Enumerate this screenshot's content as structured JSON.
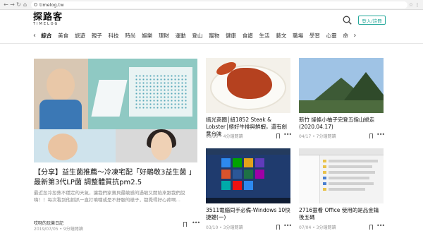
{
  "browser": {
    "url": "timelog.tw"
  },
  "header": {
    "logo_main": "探路客",
    "logo_sub": "TIMELOG",
    "login_label": "登入/註冊"
  },
  "categories": [
    "綜合",
    "美食",
    "旅遊",
    "親子",
    "科技",
    "時尚",
    "娛樂",
    "理財",
    "運動",
    "登山",
    "寵物",
    "健康",
    "食譜",
    "生活",
    "藝文",
    "職場",
    "學習",
    "心靈",
    "命"
  ],
  "featured": {
    "title": "【分享】益生菌推薦～冷凍宅配「好鵰敬3益生菌 」最新第3代LP菌 調整體質抗pm2.5",
    "excerpt": "最近忽冷忽熱不穩定的天氣，讓我們家寶貝最敏感的過敏又開始來跟我們說嗨！！每次看到他抓抓一直打噴嚏或是不舒服的樣子，都覺得好心疼啊…",
    "author": "哎呀的玩樂日記",
    "meta": "2019/07/05 • 9分鐘閱讀"
  },
  "cards": [
    {
      "title": "搞光商圈│紐1852 Steak & Lobster│極好牛排與鮮蝦，還有創意台味",
      "meta": "06/30 • 4分鐘閱讀"
    },
    {
      "title": "新竹 燥條小柚子完登五指山縱走(2020.04.17)",
      "meta": "04/17 • 7分鐘閱讀"
    },
    {
      "title": "3511電腦同手必備-Windows 10快捷鍵(一)",
      "meta": "03/10 • 3分鐘閱讀"
    },
    {
      "title": "2716靈看 Office 使用的是品金鑰後五碼",
      "meta": "07/04 • 3分鐘閱讀"
    }
  ],
  "colors": {
    "accent": "#24a89a"
  }
}
